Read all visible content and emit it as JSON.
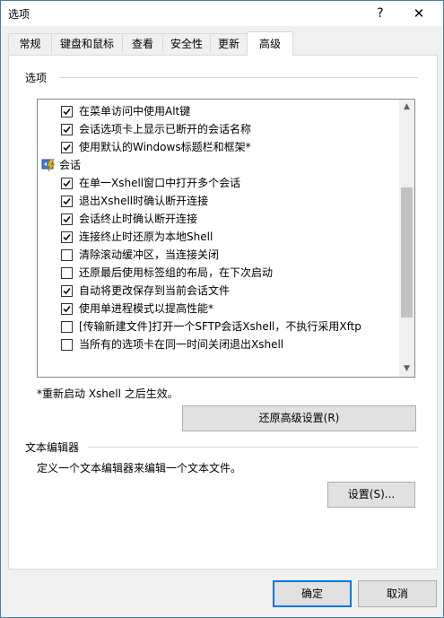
{
  "window": {
    "title": "选项",
    "help_label": "?",
    "close_label": "✕"
  },
  "tabs": [
    {
      "label": "常规"
    },
    {
      "label": "键盘和鼠标"
    },
    {
      "label": "查看"
    },
    {
      "label": "安全性"
    },
    {
      "label": "更新"
    },
    {
      "label": "高级",
      "active": true
    }
  ],
  "options_group": {
    "label": "选项"
  },
  "options_list": {
    "items": [
      {
        "type": "check",
        "checked": true,
        "label": "在菜单访问中使用Alt键"
      },
      {
        "type": "check",
        "checked": true,
        "label": "会话选项卡上显示已断开的会话名称"
      },
      {
        "type": "check",
        "checked": true,
        "label": "使用默认的Windows标题栏和框架*"
      },
      {
        "type": "category",
        "label": "会话",
        "icon": "session-icon"
      },
      {
        "type": "check",
        "checked": true,
        "label": "在单一Xshell窗口中打开多个会话"
      },
      {
        "type": "check",
        "checked": true,
        "label": "退出Xshell时确认断开连接"
      },
      {
        "type": "check",
        "checked": true,
        "label": "会话终止时确认断开连接"
      },
      {
        "type": "check",
        "checked": true,
        "label": "连接终止时还原为本地Shell"
      },
      {
        "type": "check",
        "checked": false,
        "label": "清除滚动缓冲区，当连接关闭"
      },
      {
        "type": "check",
        "checked": false,
        "label": "还原最后使用标签组的布局，在下次启动"
      },
      {
        "type": "check",
        "checked": true,
        "label": "自动将更改保存到当前会话文件"
      },
      {
        "type": "check",
        "checked": true,
        "label": "使用单进程模式以提高性能*"
      },
      {
        "type": "check",
        "checked": false,
        "label": "[传输新建文件]打开一个SFTP会话Xshell，不执行采用Xftp"
      },
      {
        "type": "check",
        "checked": false,
        "label": "当所有的选项卡在同一时间关闭退出Xshell"
      }
    ],
    "scroll_up": "▲",
    "scroll_down": "▼",
    "scroll_position": 0.62
  },
  "restart_note": "*重新启动 Xshell 之后生效。",
  "restore_button": "还原高级设置(R)",
  "editor_group": {
    "label": "文本编辑器",
    "description": "定义一个文本编辑器来编辑一个文本文件。",
    "settings_button": "设置(S)..."
  },
  "footer": {
    "ok_label": "确定",
    "cancel_label": "取消"
  },
  "colors": {
    "accent": "#0078d7",
    "border": "#3c7fb1"
  }
}
